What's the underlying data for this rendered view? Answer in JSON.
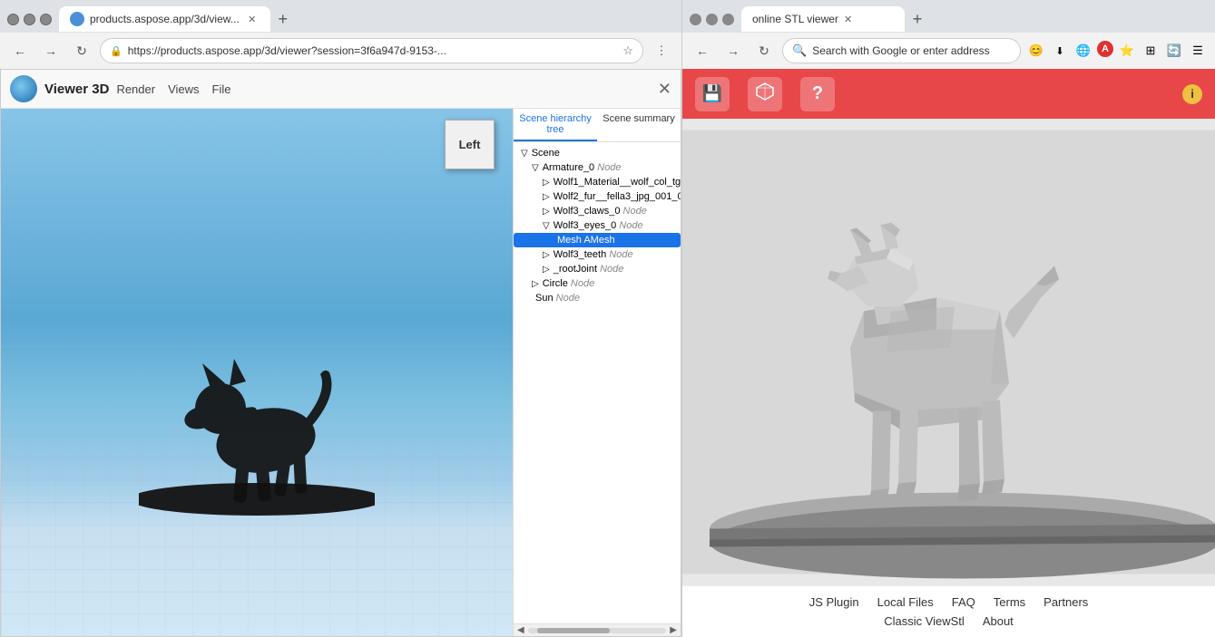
{
  "left_browser": {
    "tab": {
      "title": "products.aspose.app/3d/view...",
      "favicon": "3D"
    },
    "address_bar": {
      "url": "https://products.aspose.app/3d/viewer?session=3f6a947d-9153-...",
      "lock_icon": "🔒"
    },
    "app": {
      "logo_alt": "Aspose logo",
      "title": "Viewer 3D",
      "menu_items": [
        "Render",
        "Views",
        "File"
      ],
      "close_label": "✕"
    },
    "viewport": {
      "orientation_label": "Left",
      "scene_panel": {
        "tab1": "Scene hierarchy tree",
        "tab2": "Scene summary",
        "tree": [
          {
            "level": 1,
            "arrow": "▽",
            "text": "Scene",
            "type": ""
          },
          {
            "level": 2,
            "arrow": "▽",
            "text": "Armature_0",
            "type": " Node"
          },
          {
            "level": 3,
            "arrow": "▷",
            "text": "Wolf1_Material__wolf_col_tg...",
            "type": ""
          },
          {
            "level": 3,
            "arrow": "▷",
            "text": "Wolf2_fur__fella3_jpg_001_0...",
            "type": ""
          },
          {
            "level": 3,
            "arrow": "▷",
            "text": "Wolf3_claws_0",
            "type": " Node"
          },
          {
            "level": 3,
            "arrow": "▽",
            "text": "Wolf3_eyes_0",
            "type": " Node"
          },
          {
            "level": 4,
            "arrow": "",
            "text": "Mesh AMesh",
            "type": "",
            "selected": true
          },
          {
            "level": 3,
            "arrow": "▷",
            "text": "Wolf3_teeth",
            "type": " Node"
          },
          {
            "level": 3,
            "arrow": "▷",
            "text": "_rootJoint",
            "type": " Node"
          },
          {
            "level": 2,
            "arrow": "▷",
            "text": "Circle",
            "type": " Node"
          },
          {
            "level": 2,
            "arrow": "",
            "text": "Sun",
            "type": " Node"
          }
        ]
      }
    }
  },
  "right_browser": {
    "tab": {
      "title": "online STL viewer",
      "close": "✕"
    },
    "address_bar": {
      "placeholder": "Search with Google or enter address"
    },
    "toolbar": {
      "save_icon": "💾",
      "box_icon": "📦",
      "help_icon": "?",
      "info_icon": "i"
    },
    "footer": {
      "links_row1": [
        "JS Plugin",
        "Local Files",
        "FAQ",
        "Terms",
        "Partners"
      ],
      "links_row2": [
        "Classic ViewStl",
        "About"
      ]
    }
  }
}
